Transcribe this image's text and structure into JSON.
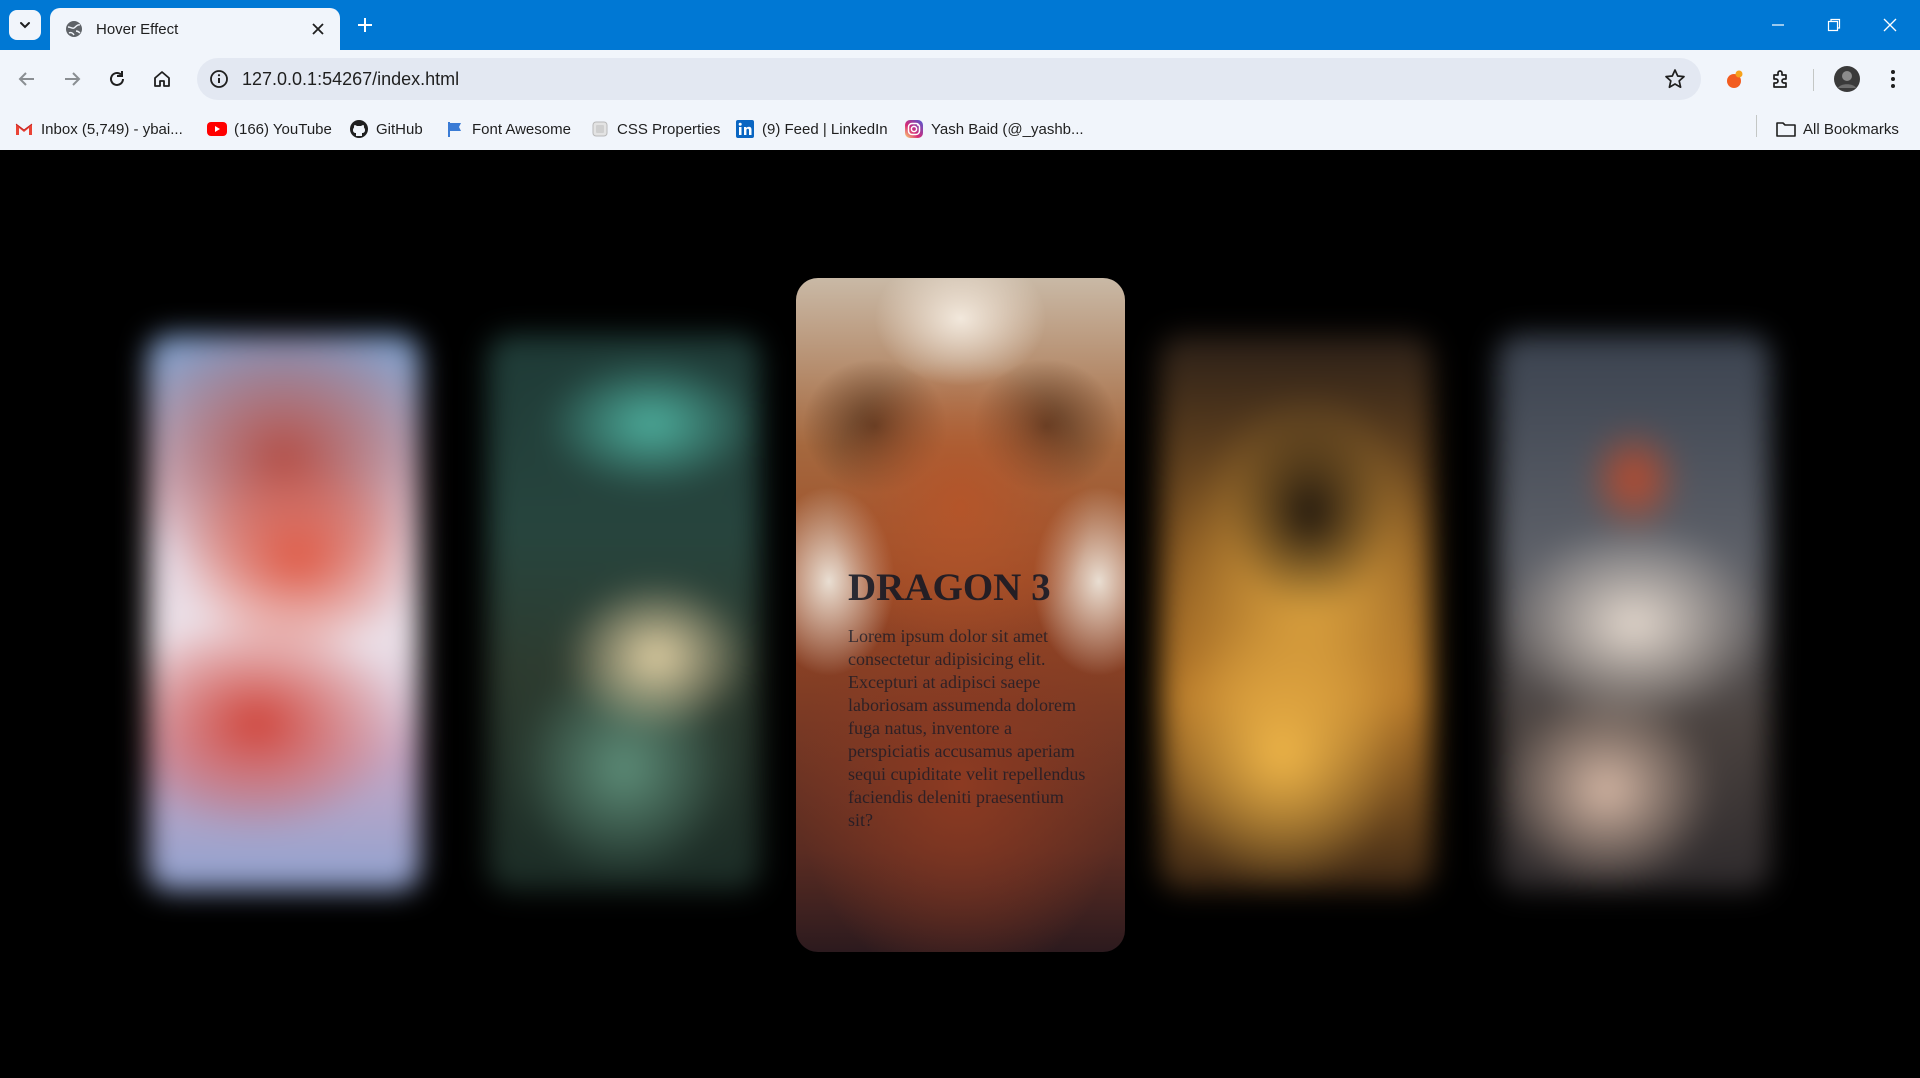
{
  "browser": {
    "tab_title": "Hover Effect",
    "url": "127.0.0.1:54267/index.html",
    "bookmarks": [
      {
        "label": "Inbox (5,749) - ybai...",
        "icon": "gmail-icon"
      },
      {
        "label": "(166) YouTube",
        "icon": "youtube-icon"
      },
      {
        "label": "GitHub",
        "icon": "github-icon"
      },
      {
        "label": "Font Awesome",
        "icon": "font-awesome-icon"
      },
      {
        "label": "CSS Properties",
        "icon": "page-icon"
      },
      {
        "label": "(9) Feed | LinkedIn",
        "icon": "linkedin-icon"
      },
      {
        "label": "Yash Baid (@_yashb...",
        "icon": "instagram-icon"
      }
    ],
    "all_bookmarks_label": "All Bookmarks",
    "accent_color": "#0078d4"
  },
  "page": {
    "cards": [
      {
        "name": "dragon-card-1",
        "focused": false
      },
      {
        "name": "dragon-card-2",
        "focused": false
      },
      {
        "name": "dragon-card-3",
        "focused": true
      },
      {
        "name": "dragon-card-4",
        "focused": false
      },
      {
        "name": "dragon-card-5",
        "focused": false
      }
    ],
    "focused_card": {
      "title": "DRAGON 3",
      "text": "Lorem ipsum dolor sit amet consectetur adipisicing elit. Excepturi at adipisci saepe laboriosam assumenda dolorem fuga natus, inventore a perspiciatis accusamus aperiam sequi cupiditate velit repellendus faciendis deleniti praesentium sit?"
    }
  }
}
